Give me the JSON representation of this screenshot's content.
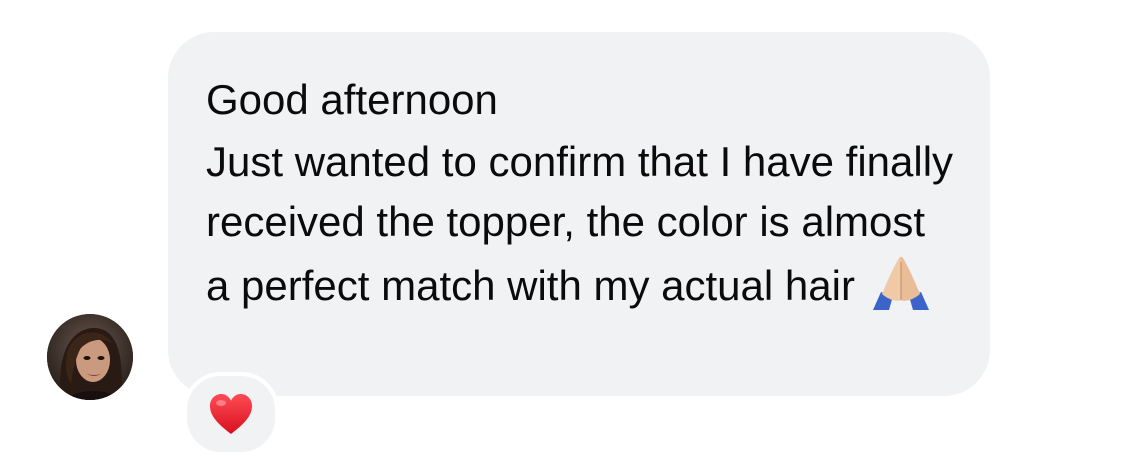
{
  "message": {
    "greeting": "Good afternoon",
    "body": "Just wanted to confirm that I have finally received the topper, the color is almost a perfect match with my actual hair",
    "emoji": "praying-hands-icon"
  },
  "sender": {
    "avatar": "avatar-photo"
  },
  "reaction": {
    "emoji": "red-heart-icon"
  },
  "colors": {
    "bubble": "#f1f2f4",
    "text": "#0b0b0b",
    "heart": "#e8202d",
    "background": "#ffffff"
  }
}
